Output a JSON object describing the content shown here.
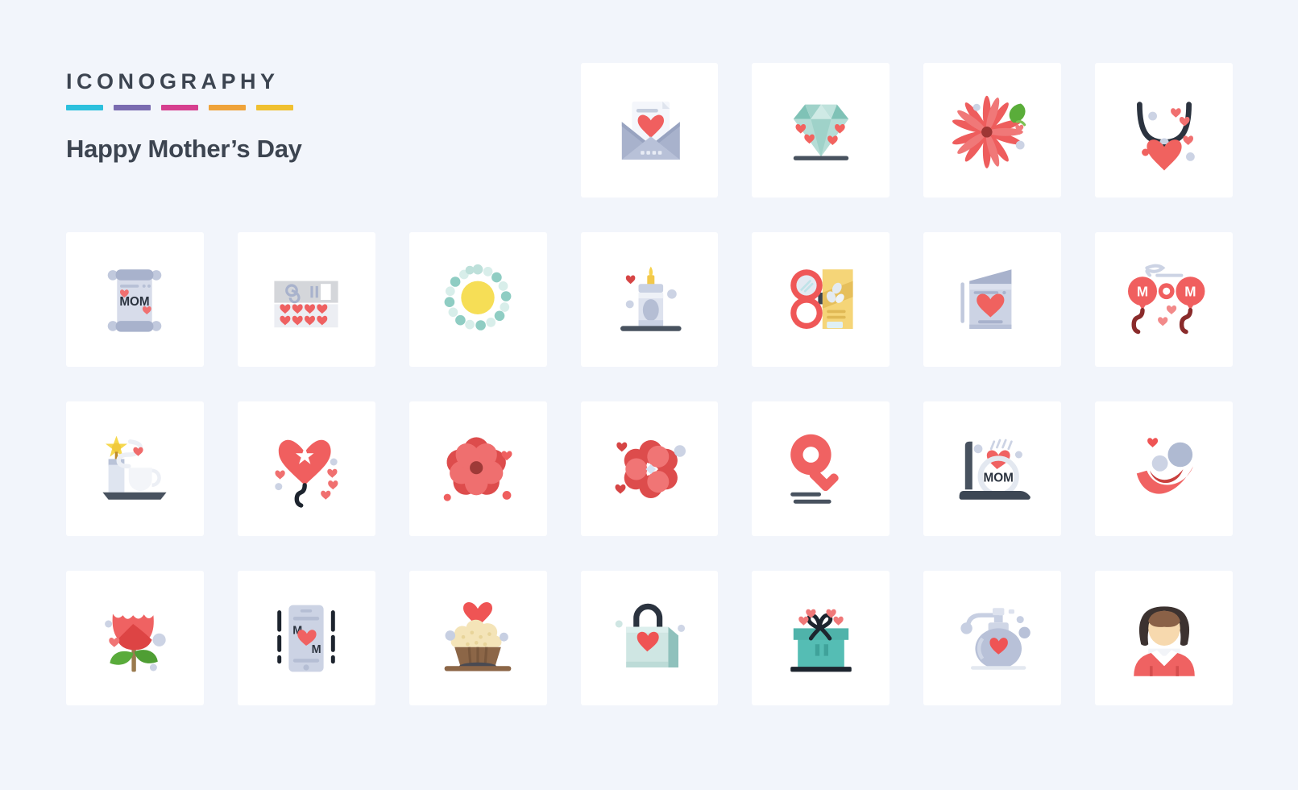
{
  "header": {
    "brand": "ICONOGRAPHY",
    "subtitle": "Happy Mother’s Day",
    "rule_colors": [
      "#2cc0dd",
      "#7a6bb0",
      "#d63f8f",
      "#efa33a",
      "#f0c030"
    ]
  },
  "theme": {
    "background": "#f2f5fb",
    "card_background": "#ffffff",
    "text": "#3c4450",
    "accent_red": "#ef5a5a",
    "accent_teal": "#6ec9c0",
    "accent_grey_blue": "#aab3ce",
    "accent_yellow": "#f6dd5c",
    "accent_dark": "#2b333f"
  },
  "grid": {
    "columns": 7,
    "rows": 4,
    "total_cells": 28,
    "icons": [
      {
        "row": 1,
        "col": 1,
        "name": "empty-slot",
        "label": ""
      },
      {
        "row": 1,
        "col": 2,
        "name": "empty-slot",
        "label": ""
      },
      {
        "row": 1,
        "col": 3,
        "name": "empty-slot",
        "label": ""
      },
      {
        "row": 1,
        "col": 4,
        "name": "love-letter-envelope-icon",
        "label": "Love letter envelope"
      },
      {
        "row": 1,
        "col": 5,
        "name": "diamond-icon",
        "label": "Diamond"
      },
      {
        "row": 1,
        "col": 6,
        "name": "daisy-flower-leaf-icon",
        "label": "Daisy flower with leaf"
      },
      {
        "row": 1,
        "col": 7,
        "name": "heart-necklace-icon",
        "label": "Heart necklace"
      },
      {
        "row": 2,
        "col": 1,
        "name": "mom-scroll-icon",
        "label": "MOM scroll"
      },
      {
        "row": 2,
        "col": 2,
        "name": "chocolate-box-icon",
        "label": "Chocolate box with hearts"
      },
      {
        "row": 2,
        "col": 3,
        "name": "pearl-bracelet-icon",
        "label": "Pearl bracelet"
      },
      {
        "row": 2,
        "col": 4,
        "name": "candle-icon",
        "label": "Candle"
      },
      {
        "row": 2,
        "col": 5,
        "name": "compact-mirror-makeup-icon",
        "label": "Compact mirror and makeup"
      },
      {
        "row": 2,
        "col": 6,
        "name": "greeting-card-heart-icon",
        "label": "Greeting card with heart"
      },
      {
        "row": 2,
        "col": 7,
        "name": "mom-balloons-icon",
        "label": "MOM balloons"
      },
      {
        "row": 3,
        "col": 1,
        "name": "candle-teacup-icon",
        "label": "Candle with hot tea cup"
      },
      {
        "row": 3,
        "col": 2,
        "name": "heart-balloon-icon",
        "label": "Heart balloon"
      },
      {
        "row": 3,
        "col": 3,
        "name": "rose-bloom-icon",
        "label": "Rose bloom"
      },
      {
        "row": 3,
        "col": 4,
        "name": "blossom-flower-icon",
        "label": "Blossom flower"
      },
      {
        "row": 3,
        "col": 5,
        "name": "female-gender-symbol-icon",
        "label": "Female gender symbol"
      },
      {
        "row": 3,
        "col": 6,
        "name": "laptop-mom-icon",
        "label": "Laptop with MOM"
      },
      {
        "row": 3,
        "col": 7,
        "name": "smiling-face-icon",
        "label": "Smiling face"
      },
      {
        "row": 4,
        "col": 1,
        "name": "tulip-flower-icon",
        "label": "Tulip flower"
      },
      {
        "row": 4,
        "col": 2,
        "name": "smartphone-mom-message-icon",
        "label": "Smartphone MOM message"
      },
      {
        "row": 4,
        "col": 3,
        "name": "cupcake-heart-icon",
        "label": "Cupcake with heart"
      },
      {
        "row": 4,
        "col": 4,
        "name": "shopping-bag-heart-icon",
        "label": "Shopping bag with heart"
      },
      {
        "row": 4,
        "col": 5,
        "name": "gift-box-icon",
        "label": "Gift box with bow"
      },
      {
        "row": 4,
        "col": 6,
        "name": "perfume-bottle-icon",
        "label": "Perfume bottle"
      },
      {
        "row": 4,
        "col": 7,
        "name": "woman-avatar-icon",
        "label": "Woman avatar"
      }
    ]
  }
}
